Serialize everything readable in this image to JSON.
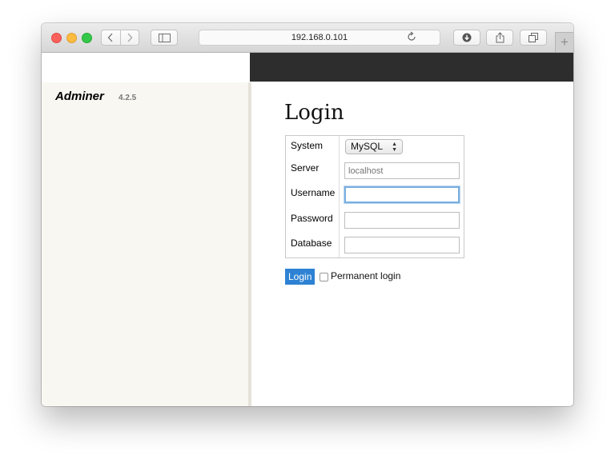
{
  "browser": {
    "url": "192.168.0.101",
    "icons": {
      "back": "chevron-left-icon",
      "forward": "chevron-right-icon",
      "sidebar": "sidebar-icon",
      "reload": "reload-icon",
      "download": "download-icon",
      "share": "share-icon",
      "tabs": "tabs-icon",
      "new_tab": "plus-icon"
    },
    "new_tab_label": "+"
  },
  "app": {
    "name": "Adminer",
    "version": "4.2.5"
  },
  "login": {
    "title": "Login",
    "fields": {
      "system": {
        "label": "System",
        "value": "MySQL"
      },
      "server": {
        "label": "Server",
        "placeholder": "localhost",
        "value": ""
      },
      "username": {
        "label": "Username",
        "value": ""
      },
      "password": {
        "label": "Password",
        "value": ""
      },
      "database": {
        "label": "Database",
        "value": ""
      }
    },
    "submit_label": "Login",
    "permanent_label": "Permanent login",
    "permanent_checked": false
  },
  "colors": {
    "accent": "#2d82d3",
    "topbar": "#2d2d2d",
    "menu_bg": "#f8f7f2"
  }
}
